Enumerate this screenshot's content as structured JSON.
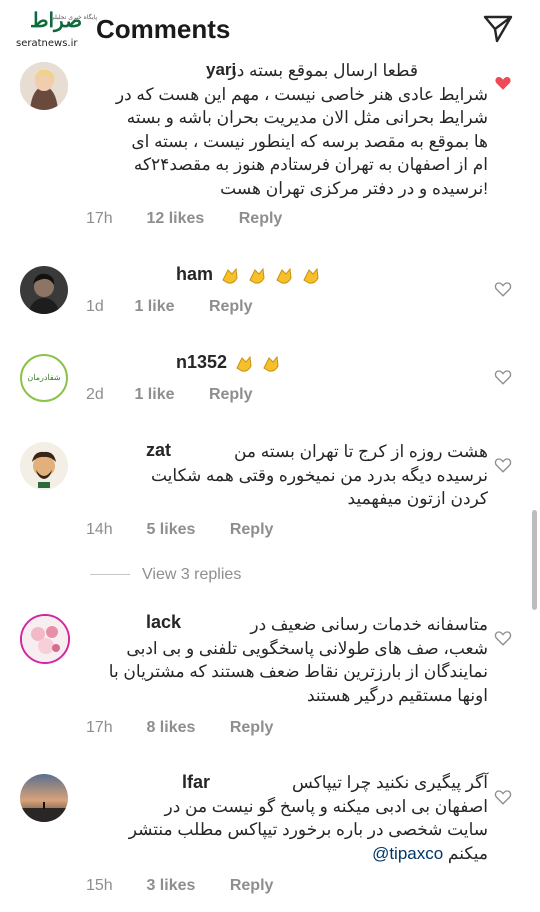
{
  "header": {
    "title": "Comments",
    "watermark_url": "seratnews.ir",
    "watermark_logo": "صراط",
    "watermark_sub": "پایگاه خبری تحلیلی"
  },
  "comments": [
    {
      "username": "yari",
      "lines": [
        "قطعا ارسال بموقع بسته در",
        "شرایط عادی هنر خاصی نیست ، مهم این هست که در",
        "شرایط بحرانی مثل الان مدیریت بحران باشه و بسته",
        "ها بموقع به مقصد برسه که اینطور نیست ، بسته ای",
        "ام از اصفهان به تهران فرستادم هنوز به مقصد۲۴که",
        "!نرسیده و در دفتر مرکزی تهران هست"
      ],
      "time": "17h",
      "likes": "12 likes",
      "reply": "Reply",
      "liked": true
    },
    {
      "username": "ham",
      "lines": [],
      "time": "1d",
      "likes": "1 like",
      "reply": "Reply",
      "liked": false
    },
    {
      "username": "n1352",
      "lines": [],
      "time": "2d",
      "likes": "1 like",
      "reply": "Reply",
      "liked": false
    },
    {
      "username": "zat",
      "lines": [
        "هشت روزه از کرج تا تهران بسته من",
        "نرسیده دیگه بدرد من نمیخوره وقتی همه شکایت",
        "کردن ازتون میفهمید"
      ],
      "time": "14h",
      "likes": "5 likes",
      "reply": "Reply",
      "liked": false
    },
    {
      "username": "lack",
      "lines": [
        "متاسفانه خدمات رسانی ضعیف در",
        "شعب، صف های طولانی پاسخگویی تلفنی و بی ادبی",
        "نمایندگان از بارزترین نقاط ضعف هستند که مشتریان با",
        "اونها مستقیم درگیر هستند"
      ],
      "time": "17h",
      "likes": "8 likes",
      "reply": "Reply",
      "liked": false
    },
    {
      "username": "lfar",
      "lines": [
        "آگر پیگیری نکنید چرا تیپاکس",
        "اصفهان بی ادبی میکنه و پاسخ گو نیست من در",
        "سایت شخصی  در باره برخورد تیپاکس مطلب منتشر",
        "میکنم"
      ],
      "mention": "@tipaxco",
      "time": "15h",
      "likes": "3 likes",
      "reply": "Reply",
      "liked": false
    }
  ],
  "view_replies": "View 3 replies",
  "avatar3_text": "شفادرمان",
  "colors": {
    "heart_liked": "#ed4956",
    "meta": "#8e8e8e",
    "text": "#262626"
  }
}
